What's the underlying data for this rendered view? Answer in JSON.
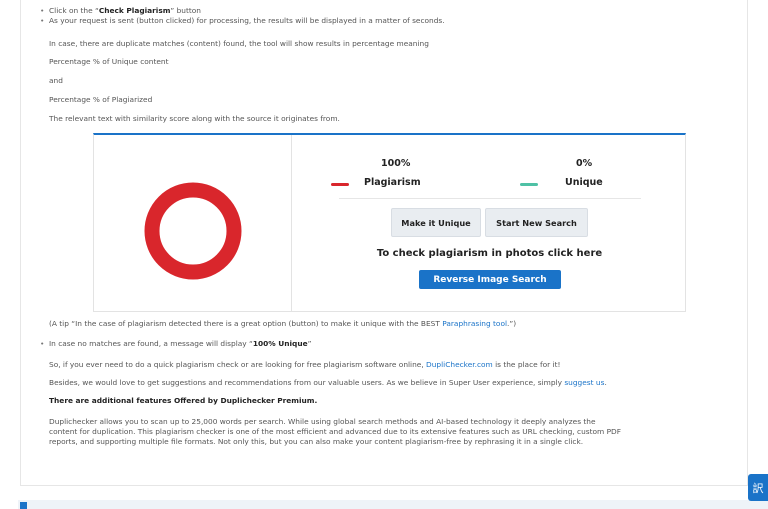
{
  "steps": {
    "line1_pre": "Click on the “",
    "line1_bold": "Check Plagiarism",
    "line1_post": "” button",
    "line2": "As your request is sent (button clicked) for processing, the results will be displayed in a matter of seconds.",
    "line3": "In case, there are duplicate matches (content) found, the tool will show results in percentage meaning",
    "line4": "Percentage % of Unique content",
    "line5": "and",
    "line6": "Percentage % of Plagiarized",
    "line7": "The relevant text with similarity score along with the source it originates from."
  },
  "result": {
    "plagiarism_value": "100%",
    "plagiarism_label": "Plagiarism",
    "unique_value": "0%",
    "unique_label": "Unique",
    "make_unique_label": "Make it Unique",
    "start_new_label": "Start New Search",
    "photo_text": "To check plagiarism in photos click here",
    "reverse_image_label": "Reverse Image Search",
    "plagiarism_color": "#d9262c",
    "unique_color": "#4fc1a5"
  },
  "chart_data": {
    "type": "pie",
    "categories": [
      "Plagiarism",
      "Unique"
    ],
    "values": [
      100,
      0
    ],
    "colors": [
      "#d9262c",
      "#4fc1a5"
    ]
  },
  "after": {
    "tip_pre": "(A tip “In the case of plagiarism detected there is a great option (button) to make it unique with the BEST ",
    "tip_link": "Paraphrasing tool",
    "tip_post": ".”)",
    "no_match_pre": "In case no matches are found, a message will display “",
    "no_match_bold": "100% Unique",
    "no_match_post": "”",
    "quick_pre": "So, if you ever need to do a quick plagiarism check or are looking for free plagiarism software online, ",
    "quick_link": "DupliChecker.com",
    "quick_post": " is the place for it!",
    "suggest_pre": "Besides, we would love to get suggestions and recommendations from our valuable users. As we believe in Super User experience, simply ",
    "suggest_link": "suggest us",
    "suggest_post": ".",
    "premium_heading": "There are additional features Offered by Duplichecker Premium.",
    "para1": "Duplichecker allows you to scan up to 25,000 words per search. While using global search methods and AI-based technology it deeply analyzes the",
    "para2": "content for duplication. This plagiarism checker is one of the most efficient and advanced due to its extensive features such as URL checking, custom PDF",
    "para3": "reports, and supporting multiple file formats. Not only this, but you can also make your content plagiarism-free by rephrasing it in a single click."
  },
  "float_button": {
    "icon": "translate-icon",
    "glyph": "訳"
  }
}
